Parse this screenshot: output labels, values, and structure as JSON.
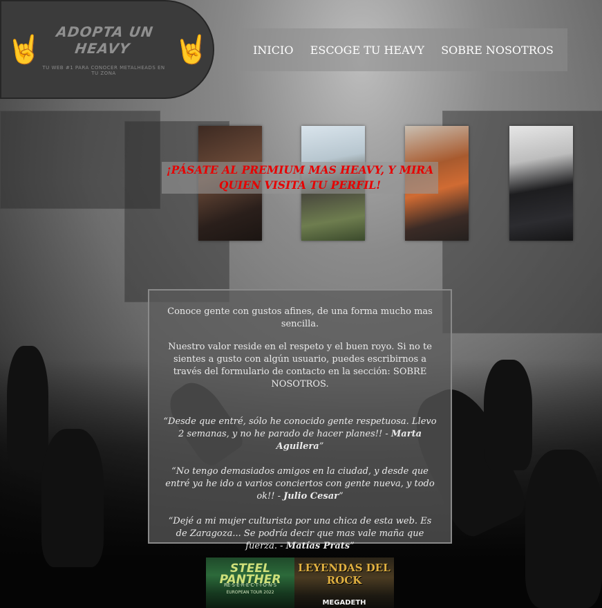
{
  "logo": {
    "title": "ADOPTA UN HEAVY",
    "subtitle": "TU WEB #1 PARA CONOCER METALHEADS EN TU ZONA"
  },
  "nav": {
    "items": [
      {
        "label": "INICIO"
      },
      {
        "label": "ESCOGE TU HEAVY"
      },
      {
        "label": "SOBRE NOSOTROS"
      }
    ]
  },
  "promo": {
    "text": "¡PÁSATE AL PREMIUM MAS HEAVY, Y MIRA QUIEN VISITA TU PERFIL!",
    "color": "#e60000"
  },
  "info": {
    "paragraph1": "Conoce gente con gustos afines, de una forma mucho mas sencilla.",
    "paragraph2": "Nuestro valor reside en el respeto y el buen royo. Si no te sientes a gusto con algún usuario, puedes escribirnos a través del formulario de contacto en la sección: SOBRE NOSOTROS.",
    "testimonials": [
      {
        "quote": "“Desde que entré, sólo he conocido gente respetuosa. Llevo 2 semanas, y no he parado de hacer planes!! - ",
        "author": "Marta Aguilera",
        "close": "”"
      },
      {
        "quote": "“No tengo demasiados amigos en la ciudad, y desde que entré ya he ido a varios conciertos con gente nueva, y todo ok!! - ",
        "author": "Julio Cesar",
        "close": "”"
      },
      {
        "quote": "“Dejé a mi mujer culturista por una chica de esta web. Es de Zaragoza... Se podría decir que mas vale maña que fuerza. - ",
        "author": "Matías Prats",
        "close": "”"
      }
    ]
  },
  "posters": [
    {
      "title": "STEEL PANTHER",
      "subtitle": "RE·S·E·R·E·C·T·I·O·N·S",
      "tour": "EUROPEAN TOUR 2022"
    },
    {
      "title": "LEYENDAS DEL ROCK",
      "band": "MEGADETH"
    }
  ]
}
